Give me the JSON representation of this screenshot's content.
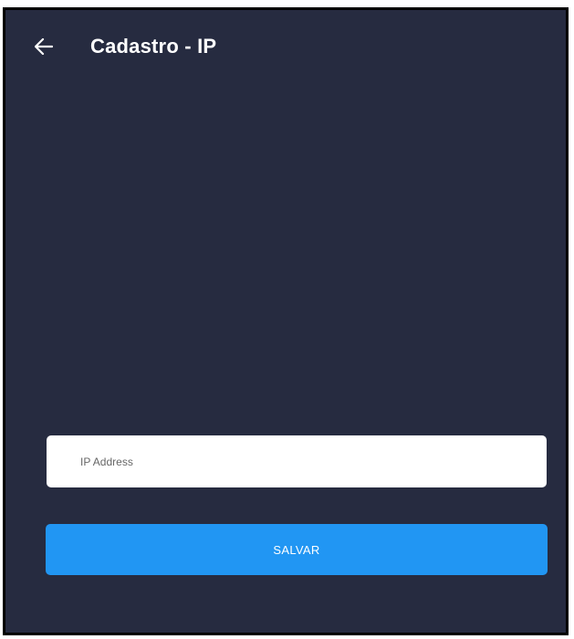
{
  "header": {
    "back_icon": "arrow-left-icon",
    "title": "Cadastro - IP"
  },
  "form": {
    "ip_address": {
      "placeholder": "IP Address",
      "value": ""
    },
    "save_label": "SALVAR"
  },
  "colors": {
    "background": "#262b40",
    "input_background": "#ffffff",
    "button_background": "#2196f3",
    "text_on_dark": "#ffffff"
  }
}
